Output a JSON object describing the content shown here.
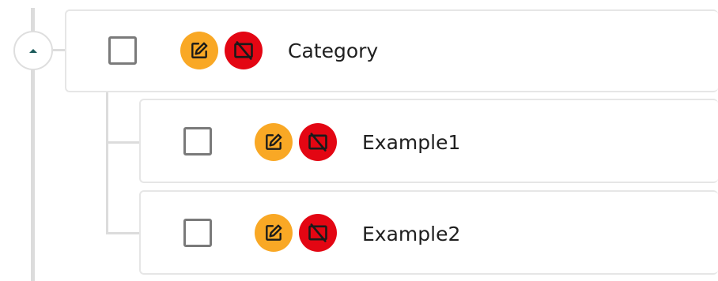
{
  "colors": {
    "edit": "#f9a825",
    "disable": "#e30613",
    "tree_line": "#dcdcdc",
    "toggle_arrow": "#1b5a5a"
  },
  "toggle": {
    "icon": "caret-up-icon",
    "state": "expanded"
  },
  "rows": [
    {
      "label": "Category",
      "checked": false,
      "edit_icon": "edit-icon",
      "disable_icon": "disable-icon"
    },
    {
      "label": "Example1",
      "checked": false,
      "edit_icon": "edit-icon",
      "disable_icon": "disable-icon"
    },
    {
      "label": "Example2",
      "checked": false,
      "edit_icon": "edit-icon",
      "disable_icon": "disable-icon"
    }
  ]
}
